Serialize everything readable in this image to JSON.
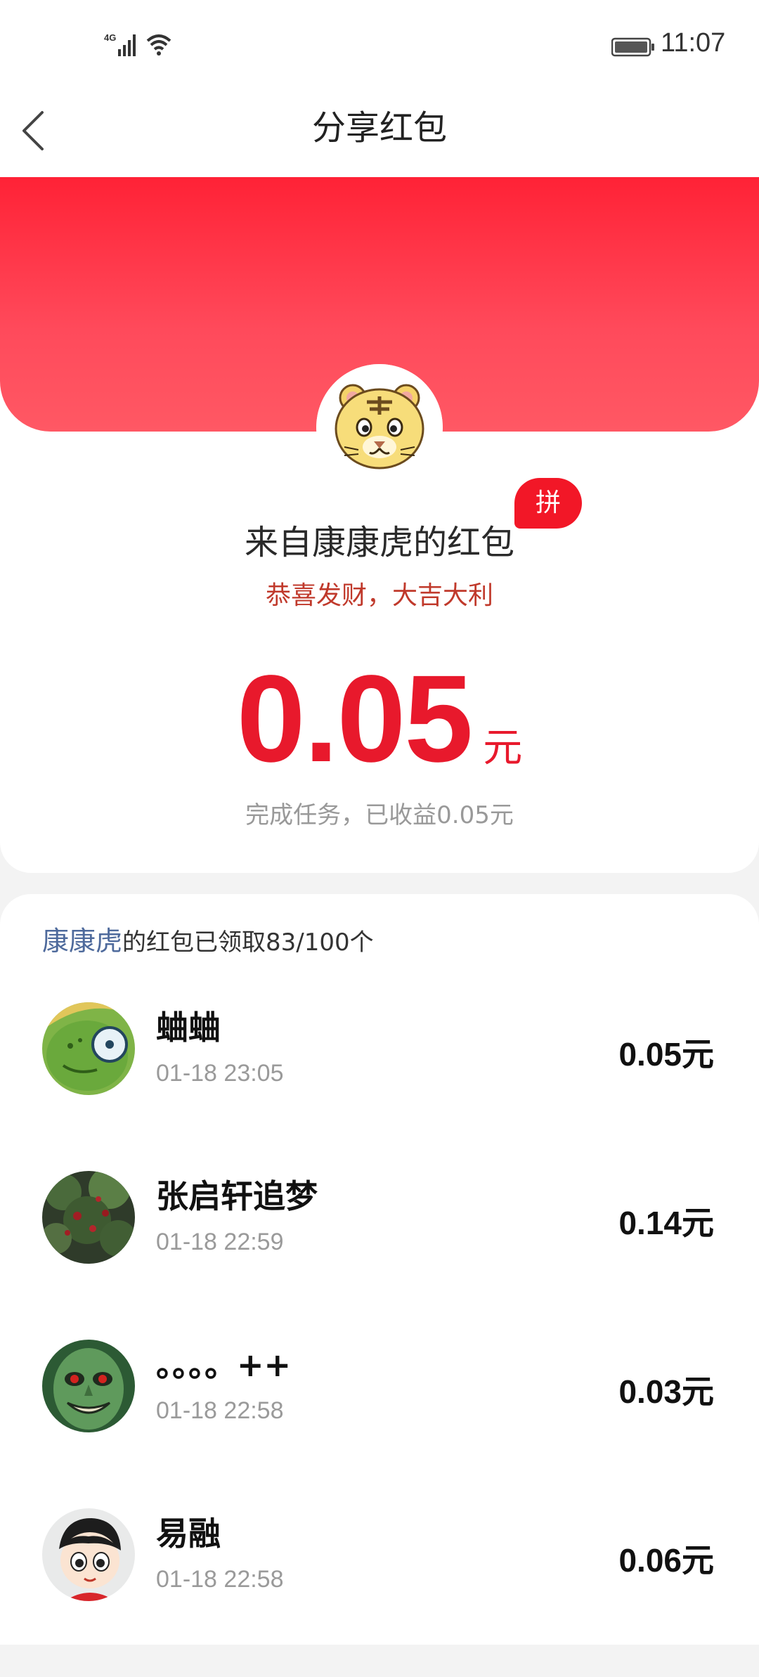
{
  "status_bar": {
    "network": "4G",
    "time": "11:07"
  },
  "header": {
    "title": "分享红包",
    "back_icon": "back-chevron-icon"
  },
  "packet": {
    "badge": "拼",
    "from_text": "来自康康虎的红包",
    "wish_text": "恭喜发财，大吉大利",
    "amount": "0.05",
    "unit": "元",
    "earned_text": "完成任务，已收益0.05元",
    "colors": {
      "red": "#e8192c",
      "band_top": "#ff2236",
      "band_bottom": "#ff5864"
    }
  },
  "list": {
    "owner_name": "康康虎",
    "summary_text": "的红包已领取83/100个",
    "items": [
      {
        "name": "蛐蛐",
        "time": "01-18 23:05",
        "amount": "0.05元"
      },
      {
        "name": "张启轩追梦",
        "time": "01-18 22:59",
        "amount": "0.14元"
      },
      {
        "name": "。。。。++",
        "time": "01-18 22:58",
        "amount": "0.03元"
      },
      {
        "name": "易融",
        "time": "01-18 22:58",
        "amount": "0.06元"
      }
    ]
  }
}
